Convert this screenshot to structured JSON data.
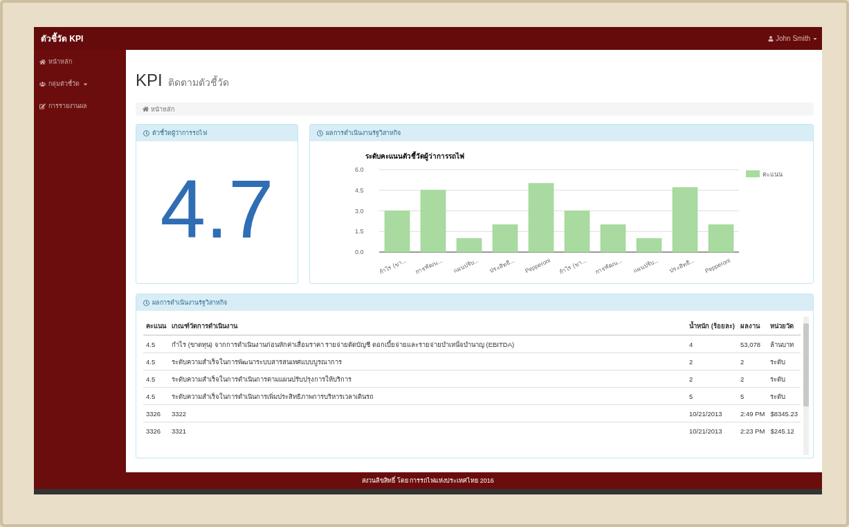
{
  "navbar": {
    "brand": "ตัวชี้วัด KPI",
    "user": "John Smith"
  },
  "sidebar": {
    "items": [
      {
        "kind": "home",
        "label": "หน้าหลัก"
      },
      {
        "kind": "dropdown",
        "label": "กลุ่มตัวชี้วัด"
      },
      {
        "kind": "report",
        "label": "การรายงานผล"
      }
    ]
  },
  "page": {
    "title": "KPI",
    "subtitle": "ติดตามตัวชี้วัด"
  },
  "breadcrumb": "หน้าหลัก",
  "score_panel": {
    "heading": "ตัวชี้วัดผู้ว่าการรถไฟ",
    "value": "4.7"
  },
  "chart_panel": {
    "heading": "ผลการดำเนินงานรัฐวิสาหกิจ",
    "chart_data": {
      "type": "bar",
      "title": "ระดับคะแนนตัวชี้วัดผู้ว่าการรถไฟ",
      "categories": [
        "กำไร (ขา...",
        "การพัฒน...",
        "แผนปรับ...",
        "ประสิทธิ...",
        "Pepperoni",
        "กำไร (ขา...",
        "การพัฒน...",
        "แผนปรับ...",
        "ประสิทธิ...",
        "Pepperoni"
      ],
      "series": [
        {
          "name": "คะแนน",
          "color": "#a9dba0",
          "values": [
            3,
            4.5,
            1,
            2,
            5,
            3,
            2,
            1,
            4.7,
            2
          ]
        }
      ],
      "grid": true,
      "ylim": [
        0,
        6
      ],
      "yticks": [
        {
          "value": 0,
          "label": "0.0"
        },
        {
          "value": 1.5,
          "label": "1.5"
        },
        {
          "value": 3,
          "label": "3.0"
        },
        {
          "value": 4.5,
          "label": "4.5"
        },
        {
          "value": 6,
          "label": "6.0"
        }
      ]
    }
  },
  "table_panel": {
    "heading": "ผลการดำเนินงานรัฐวิสาหกิจ",
    "columns": [
      "คะแนน",
      "เกณฑ์วัดการดำเนินงาน",
      "น้ำหนัก (ร้อยละ)",
      "ผลงาน",
      "หน่วยวัด"
    ],
    "rows": [
      [
        "4.5",
        "กำไร (ขาดทุน) จากการดำเนินงานก่อนหักค่าเสื่อมราคา รายจ่ายตัดบัญชี ดอกเบี้ยจ่ายและรายจ่ายบำเหน็จบำนาญ (EBITDA)",
        "4",
        "53,078",
        "ล้านบาท"
      ],
      [
        "4.5",
        "ระดับความสำเร็จในการพัฒนาระบบสารสนเทศแบบบูรณาการ",
        "2",
        "2",
        "ระดับ"
      ],
      [
        "4.5",
        "ระดับความสำเร็จในการดำเนินการตามแผนปรับปรุงการให้บริการ",
        "2",
        "2",
        "ระดับ"
      ],
      [
        "4.5",
        "ระดับความสำเร็จในการดำเนินการเพิ่มประสิทธิภาพการบริหารเวลาเดินรถ",
        "5",
        "5",
        "ระดับ"
      ],
      [
        "3326",
        "3322",
        "10/21/2013",
        "2:49 PM",
        "$8345.23"
      ],
      [
        "3326",
        "3321",
        "10/21/2013",
        "2:23 PM",
        "$245.12"
      ]
    ]
  },
  "footer": "สงวนลิขสิทธิ์ โดย การรถไฟแห่งประเทศไทย 2016"
}
